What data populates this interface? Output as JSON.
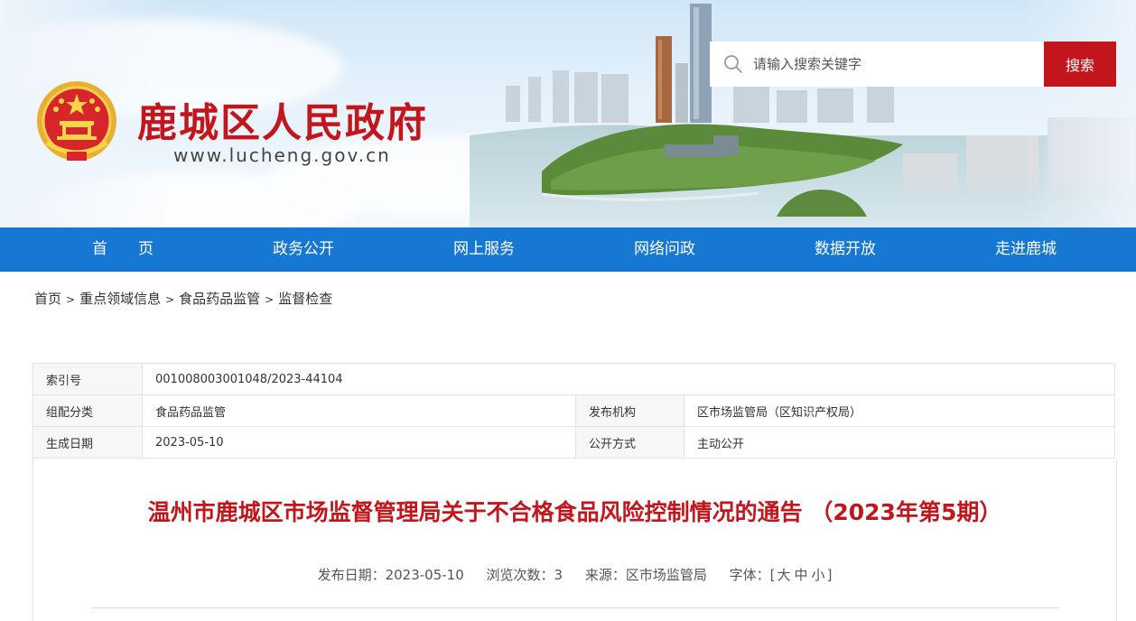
{
  "site": {
    "title": "鹿城区人民政府",
    "url": "www.lucheng.gov.cn"
  },
  "search": {
    "placeholder": "请输入搜索关键字",
    "button": "搜索"
  },
  "nav": {
    "items": [
      "首　　页",
      "政务公开",
      "网上服务",
      "网络问政",
      "数据开放",
      "走进鹿城"
    ]
  },
  "breadcrumb": [
    "首页",
    "重点领域信息",
    "食品药品监管",
    "监督检查"
  ],
  "breadcrumb_separator": ">",
  "info": {
    "index_label": "索引号",
    "index_value": "001008003001048/2023-44104",
    "category_label": "组配分类",
    "category_value": "食品药品监管",
    "publisher_label": "发布机构",
    "publisher_value": "区市场监管局（区知识产权局）",
    "date_label": "生成日期",
    "date_value": "2023-05-10",
    "open_label": "公开方式",
    "open_value": "主动公开"
  },
  "article": {
    "title": "温州市鹿城区市场监督管理局关于不合格食品风险控制情况的通告 （2023年第5期）",
    "publish_date": "发布日期：2023-05-10",
    "views": "浏览次数：3",
    "source": "来源：区市场监管局",
    "font_label": "字体：[",
    "font_large": "大",
    "font_medium": "中",
    "font_small": "小",
    "font_end": "]"
  },
  "colors": {
    "brand_red": "#c3161c",
    "nav_blue": "#1778d4"
  }
}
